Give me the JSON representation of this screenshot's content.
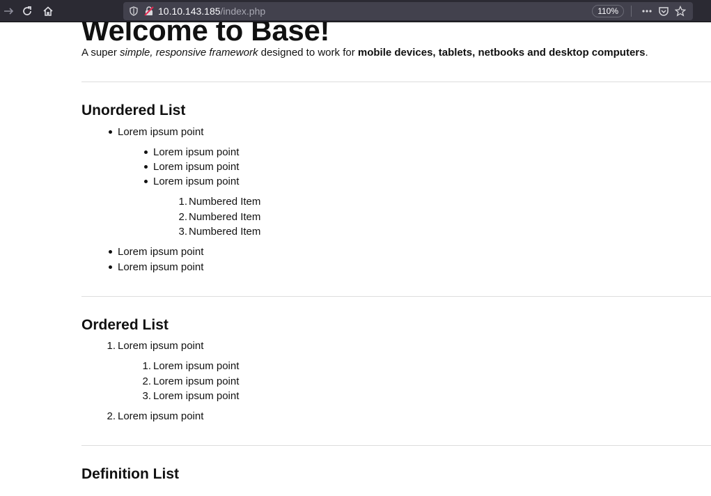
{
  "browser": {
    "url_host": "10.10.143.185",
    "url_path": "/index.php",
    "zoom": "110%",
    "icons": {
      "back": "arrow-right-icon",
      "reload": "reload-icon",
      "home": "home-icon",
      "tracking": "shield-icon",
      "insecure": "insecure-lock-icon",
      "menu": "more-icon",
      "pocket": "pocket-icon",
      "bookmark": "star-icon"
    }
  },
  "page": {
    "title": "Welcome to Base!",
    "lead": {
      "part1": "A super ",
      "em": "simple, responsive framework",
      "part2": " designed to work for ",
      "strong": "mobile devices, tablets, netbooks and desktop computers",
      "part3": "."
    },
    "unordered": {
      "heading": "Unordered List",
      "items": [
        "Lorem ipsum point",
        "Lorem ipsum point",
        "Lorem ipsum point",
        "Lorem ipsum point",
        "Lorem ipsum point",
        "Lorem ipsum point"
      ],
      "numbered": [
        {
          "n": "1.",
          "text": "Numbered Item"
        },
        {
          "n": "2.",
          "text": "Numbered Item"
        },
        {
          "n": "3.",
          "text": "Numbered Item"
        }
      ]
    },
    "ordered": {
      "heading": "Ordered List",
      "outer": [
        {
          "n": "1.",
          "text": "Lorem ipsum point"
        },
        {
          "n": "2.",
          "text": "Lorem ipsum point"
        }
      ],
      "inner": [
        {
          "n": "1.",
          "text": "Lorem ipsum point"
        },
        {
          "n": "2.",
          "text": "Lorem ipsum point"
        },
        {
          "n": "3.",
          "text": "Lorem ipsum point"
        }
      ]
    },
    "definition": {
      "heading": "Definition List"
    }
  }
}
